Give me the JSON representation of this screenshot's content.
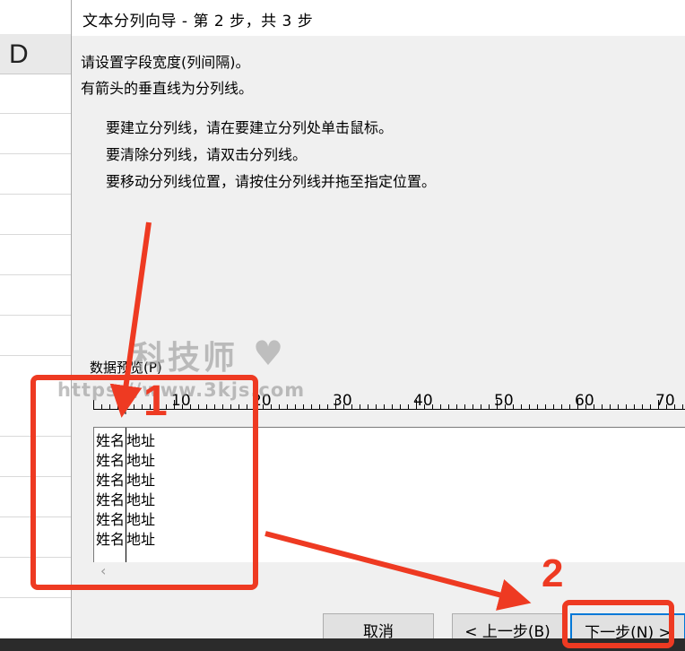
{
  "spreadsheet": {
    "column_label": "D"
  },
  "dialog": {
    "title": "文本分列向导 - 第 2 步，共 3 步",
    "intro_line1": "请设置字段宽度(列间隔)。",
    "intro_line2": "有箭头的垂直线为分列线。",
    "instructions": [
      "要建立分列线，请在要建立分列处单击鼠标。",
      "要清除分列线，请双击分列线。",
      "要移动分列线位置，请按住分列线并拖至指定位置。"
    ],
    "preview_label": "数据预览(P)",
    "ruler_labels": [
      "10",
      "20",
      "30",
      "40",
      "50",
      "60",
      "70"
    ],
    "preview_rows": [
      {
        "f1": "姓名",
        "f2": "地址"
      },
      {
        "f1": "姓名",
        "f2": "地址"
      },
      {
        "f1": "姓名",
        "f2": "地址"
      },
      {
        "f1": "姓名",
        "f2": "地址"
      },
      {
        "f1": "姓名",
        "f2": "地址"
      },
      {
        "f1": "姓名",
        "f2": "地址"
      }
    ],
    "scroll_left_glyph": "‹",
    "buttons": {
      "cancel": "取消",
      "back": "< 上一步(B)",
      "next": "下一步(N) >"
    }
  },
  "annotations": {
    "watermark_text": "科技师",
    "watermark_heart": "♥",
    "watermark_url": "https://www.3kjs.com",
    "step1_label": "1",
    "step2_label": "2",
    "accent_color": "#ee3a22"
  }
}
